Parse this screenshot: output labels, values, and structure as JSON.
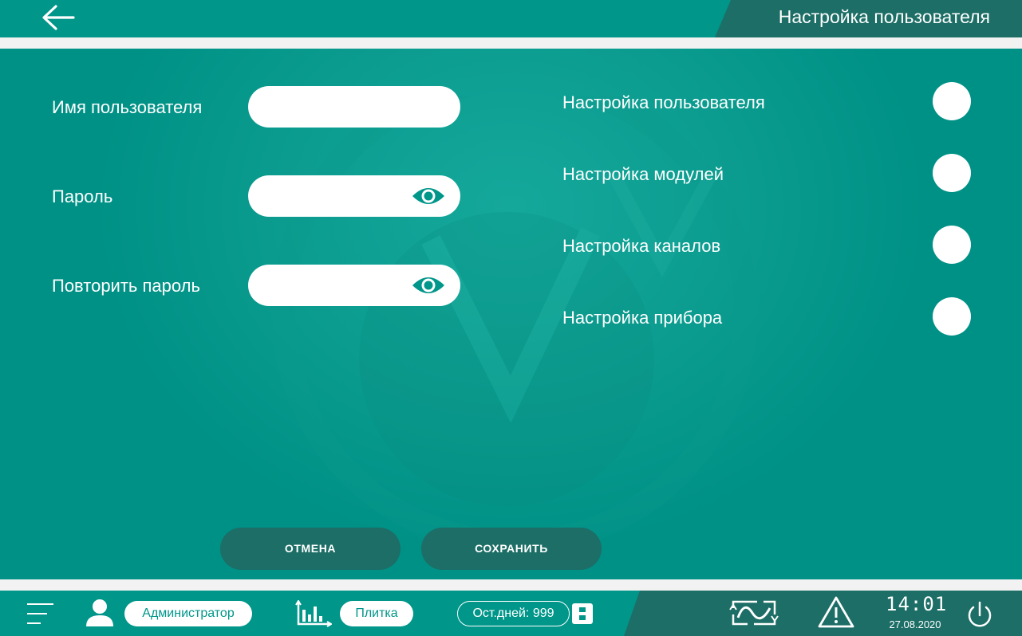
{
  "header": {
    "title": "Настройка пользователя",
    "back_icon": "arrow-left-icon"
  },
  "form": {
    "username_label": "Имя пользователя",
    "username_value": "",
    "password_label": "Пароль",
    "password_value": "",
    "repeat_password_label": "Повторить пароль",
    "repeat_password_value": "",
    "eye_icon": "eye-icon"
  },
  "permissions": [
    {
      "label": "Настройка пользователя",
      "enabled": false
    },
    {
      "label": "Настройка модулей",
      "enabled": false
    },
    {
      "label": "Настройка каналов",
      "enabled": false
    },
    {
      "label": "Настройка прибора",
      "enabled": false
    }
  ],
  "actions": {
    "cancel_label": "ОТМЕНА",
    "save_label": "СОХРАНИТЬ"
  },
  "status_bar": {
    "user_role": "Администратор",
    "view_mode": "Плитка",
    "days_left": "Ост.дней: 999",
    "time": "14:01",
    "date": "27.08.2020",
    "icons": [
      "menu-icon",
      "user-icon",
      "chart-icon",
      "storage-icon",
      "signal-icon",
      "warning-icon",
      "power-icon"
    ]
  },
  "colors": {
    "primary": "#00968a",
    "dark": "#1c6e66",
    "strip": "#f2f2f2",
    "white": "#ffffff"
  }
}
